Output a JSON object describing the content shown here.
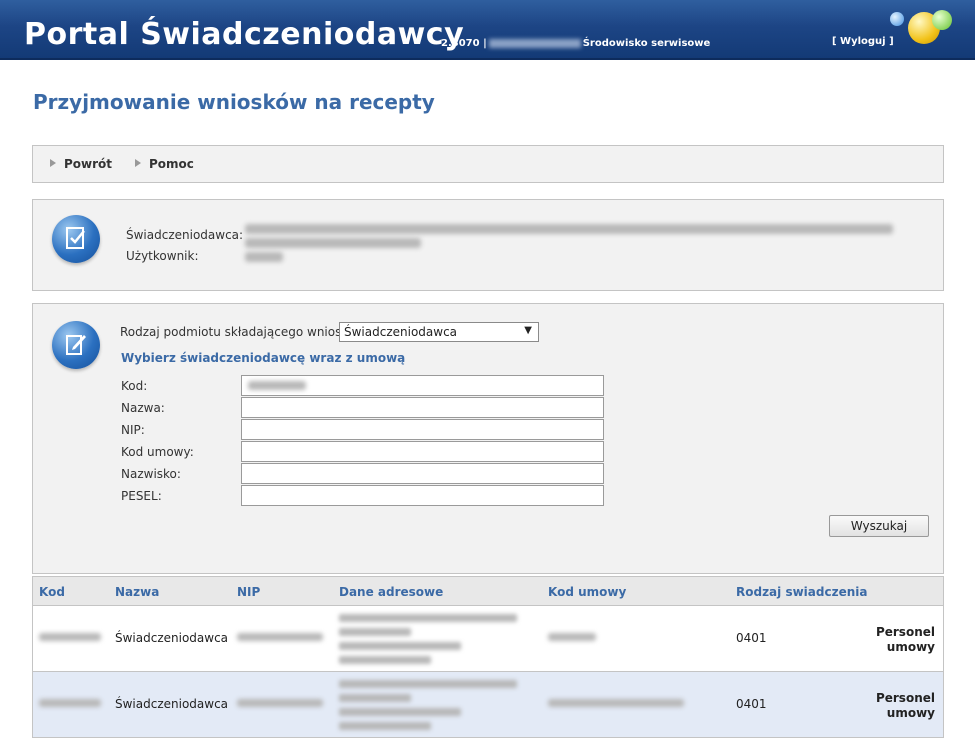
{
  "header": {
    "title": "Portal Świadczeniodawcy",
    "version": "2.3070 |",
    "environment": "Środowisko serwisowe",
    "logout": "[ Wyloguj ]"
  },
  "page_title": "Przyjmowanie wniosków na recepty",
  "nav": {
    "back": "Powrót",
    "help": "Pomoc"
  },
  "info": {
    "provider_label": "Świadczeniodawca:",
    "user_label": "Użytkownik:"
  },
  "search": {
    "entity_type_label": "Rodzaj podmiotu składającego wniosek:",
    "entity_type_value": "Świadczeniodawca",
    "subtitle": "Wybierz świadczeniodawcę wraz z umową",
    "fields": {
      "kod": "Kod:",
      "nazwa": "Nazwa:",
      "nip": "NIP:",
      "kod_umowy": "Kod umowy:",
      "nazwisko": "Nazwisko:",
      "pesel": "PESEL:"
    },
    "search_button": "Wyszukaj"
  },
  "table": {
    "columns": [
      "Kod",
      "Nazwa",
      "NIP",
      "Dane adresowe",
      "Kod umowy",
      "Rodzaj swiadczenia"
    ],
    "rows": [
      {
        "nazwa": "Świadczeniodawca",
        "rodzaj": "0401",
        "action": "Personel umowy"
      },
      {
        "nazwa": "Świadczeniodawca",
        "rodzaj": "0401",
        "action": "Personel umowy"
      }
    ]
  },
  "colors": {
    "header_blue": "#1d4585",
    "title_blue": "#3b6aa6",
    "row_highlight": "#e3eaf6"
  }
}
